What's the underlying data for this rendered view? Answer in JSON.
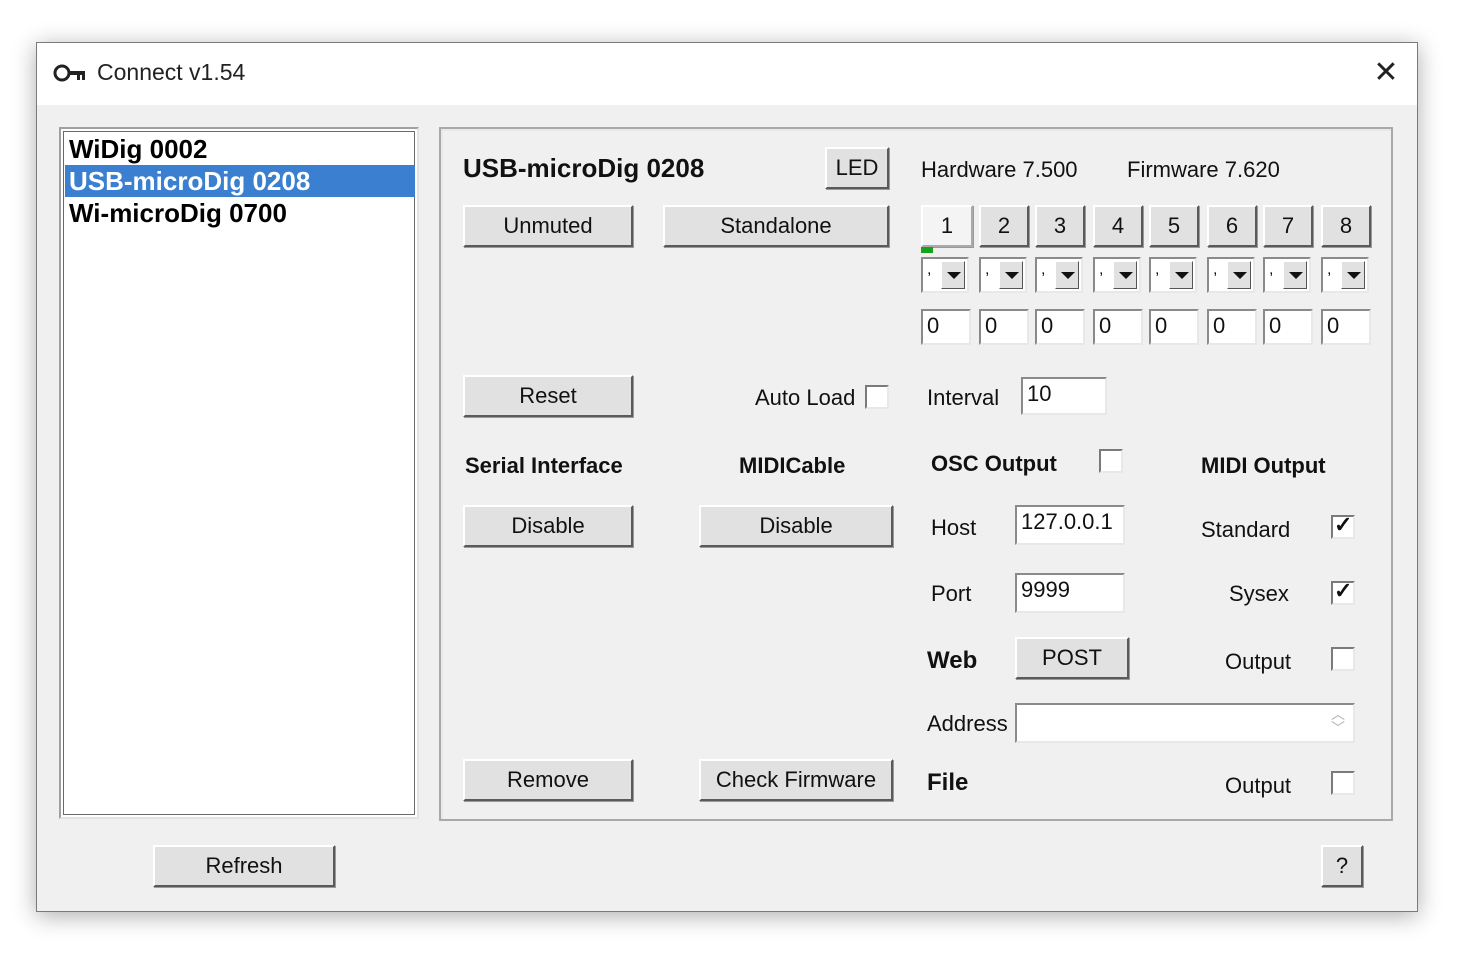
{
  "window": {
    "title": "Connect v1.54",
    "close_glyph": "✕",
    "icon": "key-icon"
  },
  "device_list": {
    "items": [
      "WiDig 0002",
      "USB-microDig 0208",
      "Wi-microDig 0700"
    ],
    "selected_index": 1
  },
  "device": {
    "name": "USB-microDig 0208",
    "led_label": "LED",
    "hardware": "Hardware 7.500",
    "firmware": "Firmware 7.620",
    "unmuted_label": "Unmuted",
    "standalone_label": "Standalone",
    "reset_label": "Reset",
    "auto_load_label": "Auto Load",
    "auto_load_checked": false,
    "interval_label": "Interval",
    "interval_value": "10"
  },
  "inputs": {
    "tabs": [
      "1",
      "2",
      "3",
      "4",
      "5",
      "6",
      "7",
      "8"
    ],
    "active_tab": "1",
    "combo_values": [
      ",",
      ",",
      ",",
      ",",
      ",",
      ",",
      ",",
      ","
    ],
    "values": [
      "0",
      "0",
      "0",
      "0",
      "0",
      "0",
      "0",
      "0"
    ]
  },
  "serial": {
    "heading": "Serial Interface",
    "button": "Disable"
  },
  "midicable": {
    "heading": "MIDICable",
    "button": "Disable"
  },
  "osc": {
    "heading": "OSC Output",
    "enabled": false,
    "host_label": "Host",
    "host_value": "127.0.0.1",
    "port_label": "Port",
    "port_value": "9999"
  },
  "web": {
    "heading": "Web",
    "post_label": "POST",
    "address_label": "Address",
    "address_value": ""
  },
  "midi_output": {
    "heading": "MIDI Output",
    "standard_label": "Standard",
    "standard_checked": true,
    "sysex_label": "Sysex",
    "sysex_checked": true,
    "output_label": "Output",
    "output_checked": false
  },
  "file": {
    "heading": "File",
    "output_label": "Output",
    "output_checked": false
  },
  "footer": {
    "remove_label": "Remove",
    "check_firmware_label": "Check Firmware",
    "refresh_label": "Refresh",
    "help_label": "?"
  },
  "colors": {
    "selection": "#3b7fd0",
    "indicator": "#1aa01a",
    "window_bg": "#f0f0f0"
  }
}
